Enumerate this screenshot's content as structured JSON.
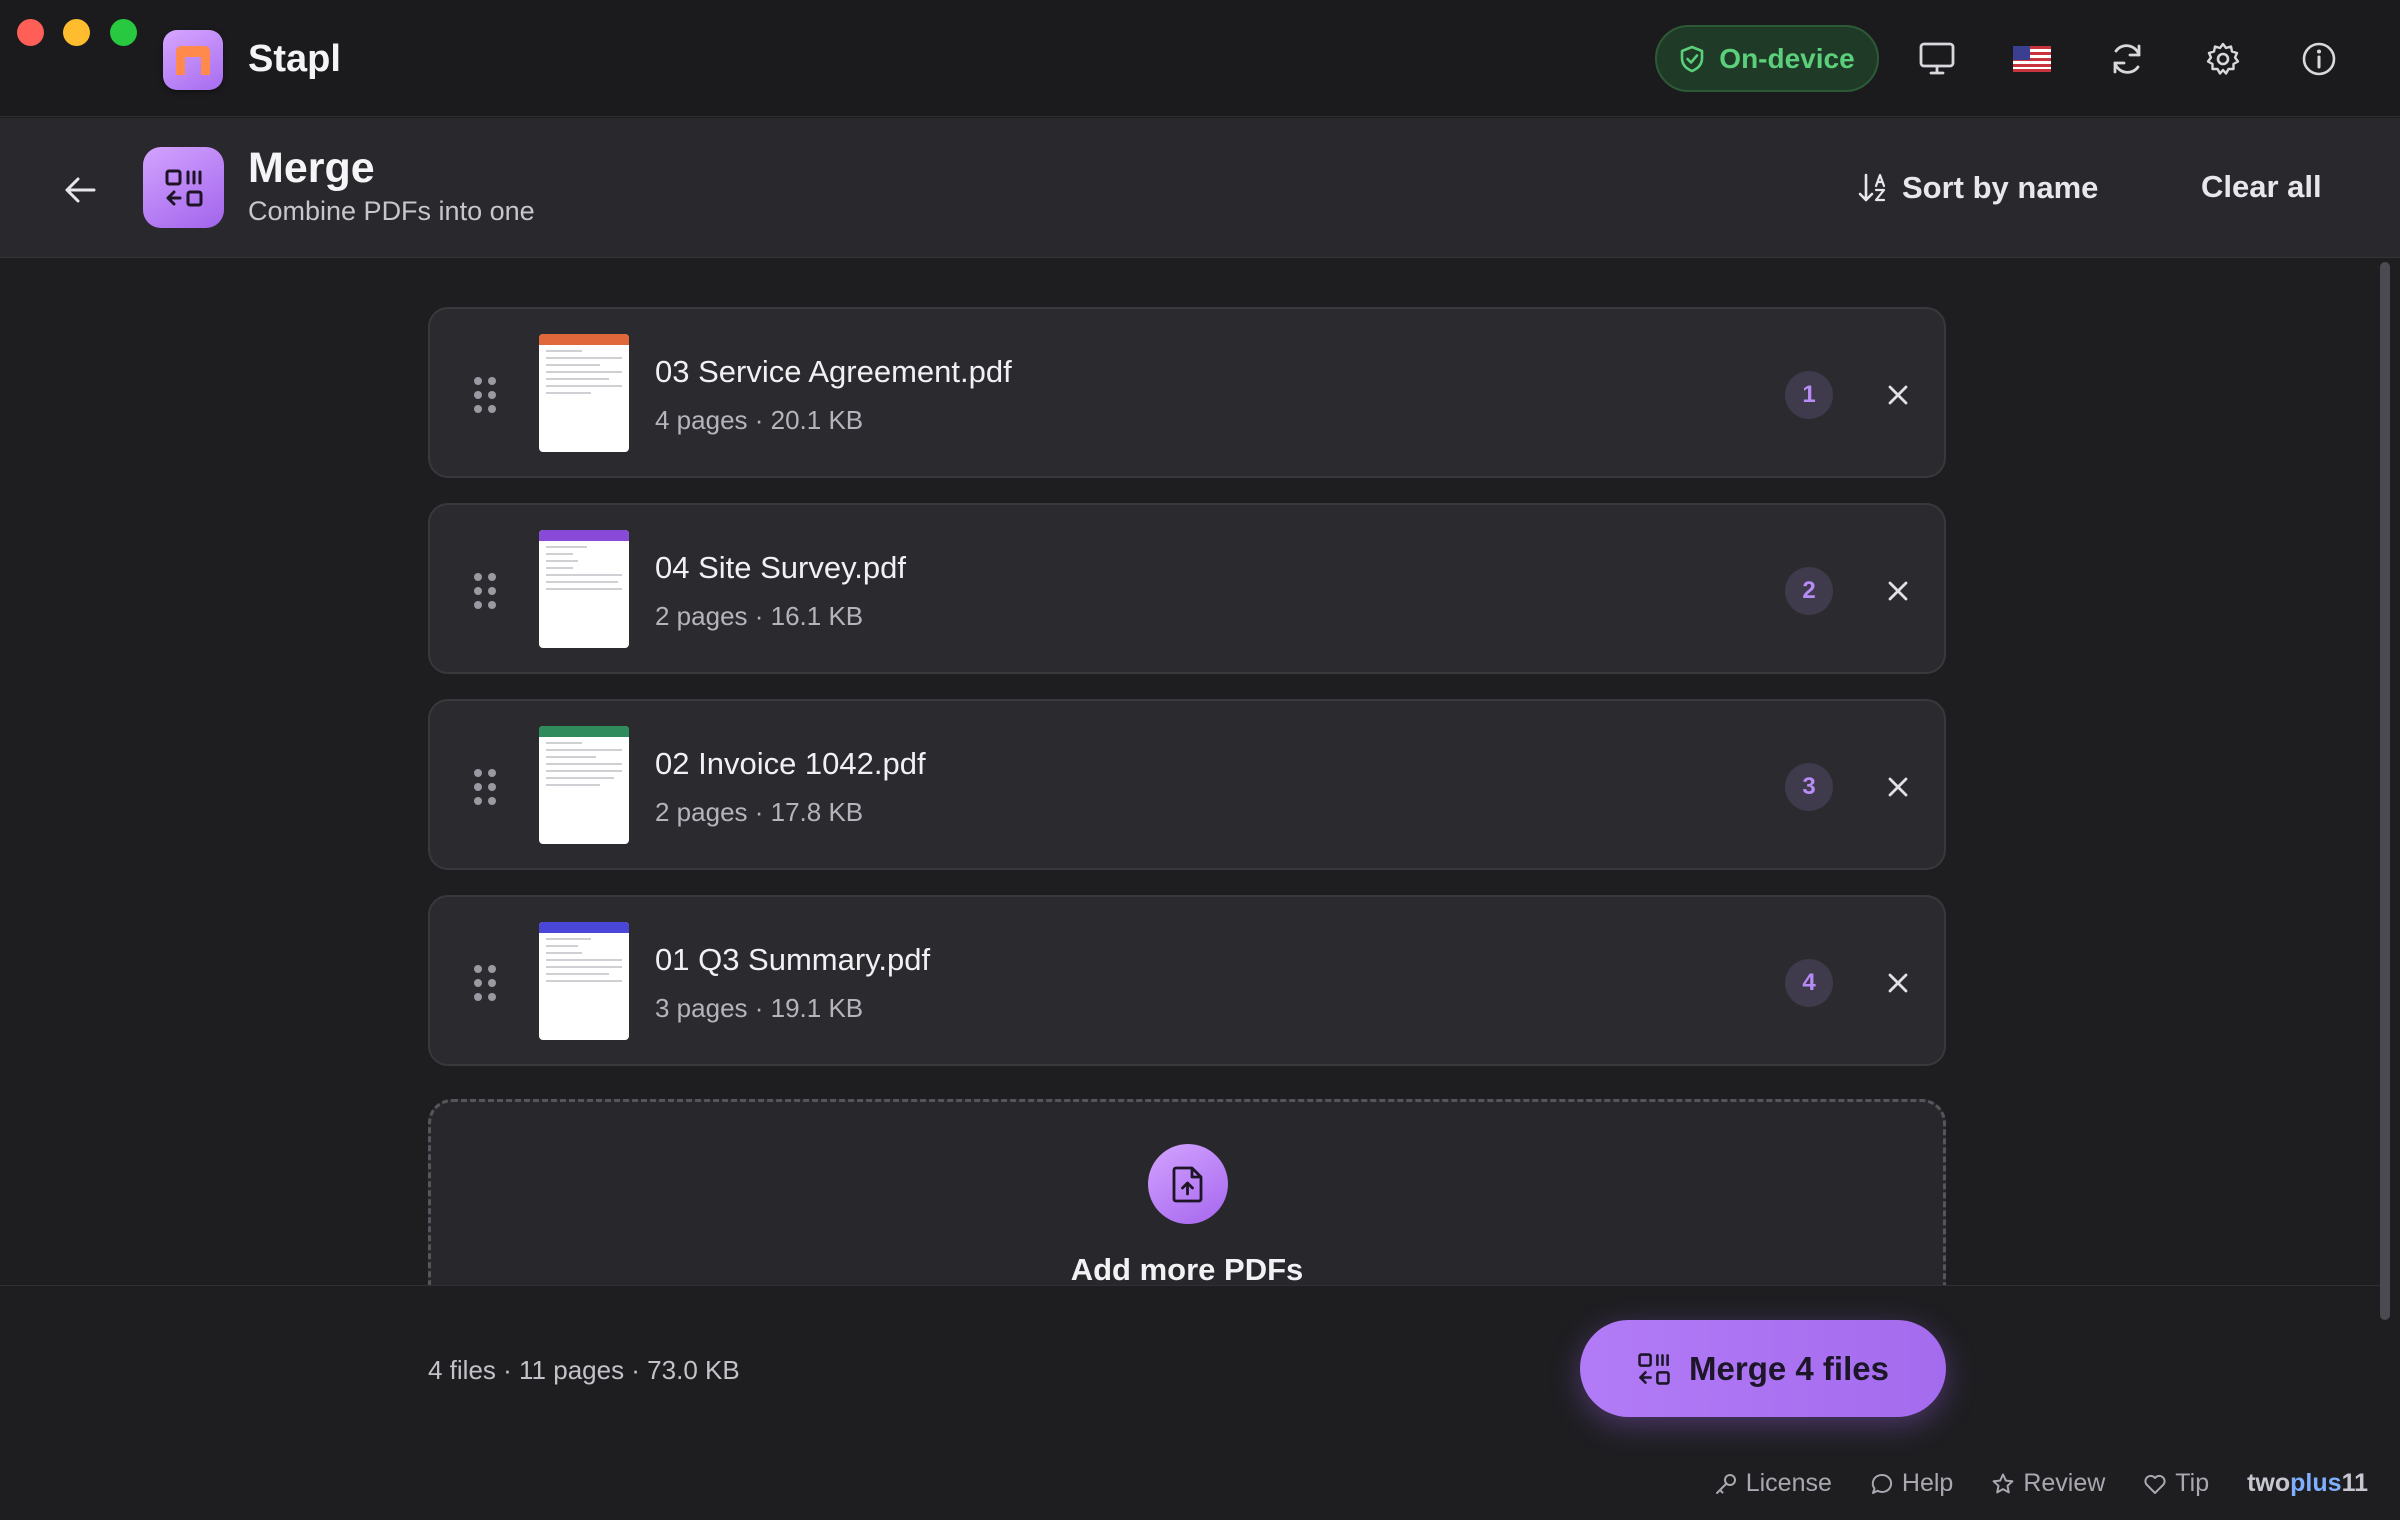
{
  "app": {
    "name": "Stapl"
  },
  "toolbar": {
    "privacy_badge": "On-device",
    "icons": [
      "monitor-icon",
      "us-flag-icon",
      "refresh-icon",
      "gear-icon",
      "info-icon"
    ]
  },
  "header": {
    "title": "Merge",
    "subtitle": "Combine PDFs into one",
    "sort_label": "Sort by name",
    "clear_label": "Clear all"
  },
  "files": [
    {
      "name": "03 Service Agreement.pdf",
      "meta": "4 pages · 20.1 KB",
      "order": "1",
      "accent": "#e0683a"
    },
    {
      "name": "04 Site Survey.pdf",
      "meta": "2 pages · 16.1 KB",
      "order": "2",
      "accent": "#8a4ad8"
    },
    {
      "name": "02 Invoice 1042.pdf",
      "meta": "2 pages · 17.8 KB",
      "order": "3",
      "accent": "#2f8a5c"
    },
    {
      "name": "01 Q3 Summary.pdf",
      "meta": "3 pages · 19.1 KB",
      "order": "4",
      "accent": "#4a46d8"
    }
  ],
  "dropzone": {
    "label": "Add more PDFs"
  },
  "footer": {
    "summary": "4 files · 11 pages · 73.0 KB",
    "merge_label": "Merge 4 files",
    "links": {
      "license": "License",
      "help": "Help",
      "review": "Review",
      "tip": "Tip"
    },
    "brand_prefix": "two",
    "brand_highlight": "plus",
    "brand_suffix": "11"
  },
  "colors": {
    "accent": "#a86ff0",
    "success": "#5bd07a",
    "background": "#1e1e21"
  }
}
